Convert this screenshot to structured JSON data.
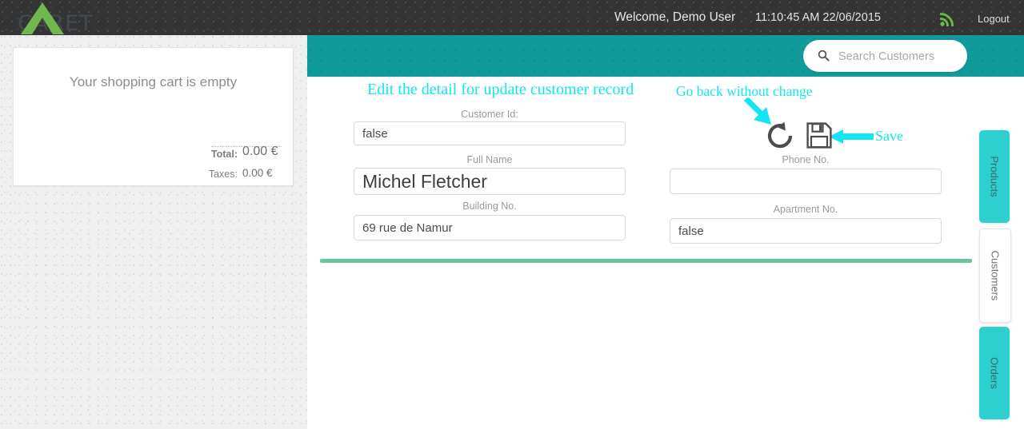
{
  "header": {
    "logo_text": "CARET",
    "welcome": "Welcome, Demo User",
    "datetime": "11:10:45 AM 22/06/2015",
    "rss_icon": "rss-icon",
    "logout_label": "Logout"
  },
  "cart": {
    "empty_message": "Your shopping cart is empty",
    "total_label": "Total:",
    "total_value": "0.00 €",
    "taxes_label": "Taxes:",
    "taxes_value": "0.00 €"
  },
  "search": {
    "placeholder": "Search Customers",
    "value": "",
    "icon": "search-icon"
  },
  "annotations": {
    "title": "Edit the detail for update customer record",
    "go_back": "Go back without change",
    "save": "Save",
    "color": "#13e6f3"
  },
  "actions": {
    "undo_icon": "undo-icon",
    "save_icon": "floppy-disk-icon"
  },
  "form": {
    "fields": [
      {
        "label": "Customer Id:",
        "value": "false"
      },
      {
        "label": "Full Name",
        "value": "Michel Fletcher"
      },
      {
        "label": "Building No.",
        "value": "69 rue de Namur"
      },
      {
        "label": "Phone No.",
        "value": ""
      },
      {
        "label": "Apartment No.",
        "value": "false"
      }
    ]
  },
  "side_tabs": [
    {
      "label": "Products",
      "active": false
    },
    {
      "label": "Customers",
      "active": true
    },
    {
      "label": "Orders",
      "active": false
    }
  ],
  "colors": {
    "teal": "#119a9a",
    "dark_header": "#343434",
    "accent_cyan": "#13e6f3",
    "green_divider": "#6ac698",
    "tab_teal": "#2ed0cf",
    "logo_green": "#72b74e"
  }
}
